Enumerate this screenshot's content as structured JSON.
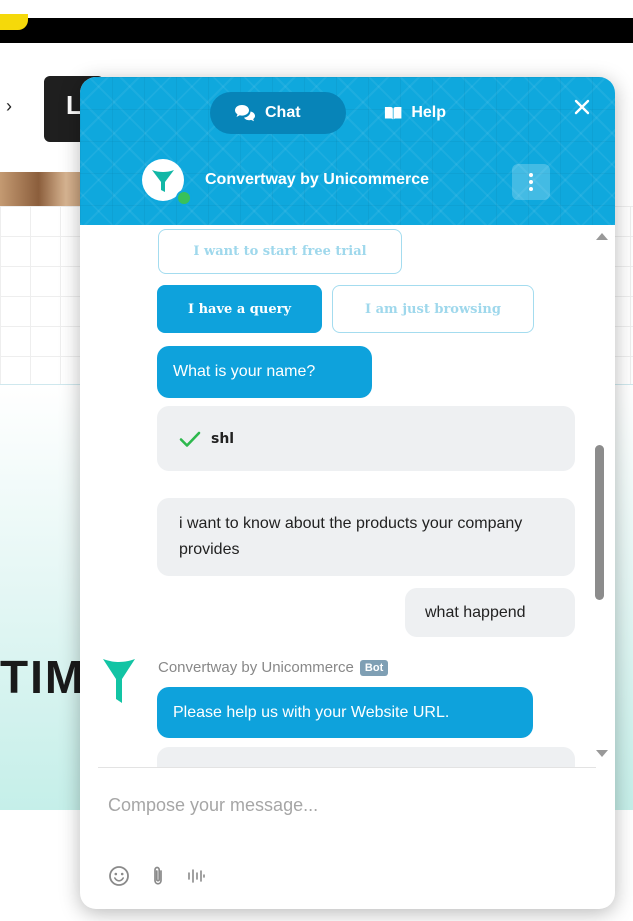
{
  "background": {
    "button_letter": "L",
    "big_text": "TIM"
  },
  "widget": {
    "tabs": [
      {
        "label": "Chat",
        "icon": "chat-bubbles-icon",
        "active": true
      },
      {
        "label": "Help",
        "icon": "book-icon",
        "active": false
      }
    ],
    "brand_name": "Convertway by Unicommerce",
    "status": "online",
    "colors": {
      "header": "#0fa8dd",
      "accent": "#0ea2dc",
      "user_bubble": "#eef0f2",
      "online": "#39c15a",
      "check": "#2db84d"
    }
  },
  "messages": {
    "option_start_trial": "I want to start free trial",
    "option_query": "I have a query",
    "option_browsing": "I am just browsing",
    "bot_question_name": "What is your name?",
    "user_answer_name": "shl",
    "user_message_products": "i want to know about the products your company provides",
    "user_message_what": "what happend",
    "bot_sender_name": "Convertway by Unicommerce",
    "bot_badge": "Bot",
    "bot_message_url": "Please help us with your Website URL."
  },
  "composer": {
    "placeholder": "Compose your message...",
    "tools": [
      "emoji-icon",
      "attachment-icon",
      "voice-icon"
    ]
  }
}
